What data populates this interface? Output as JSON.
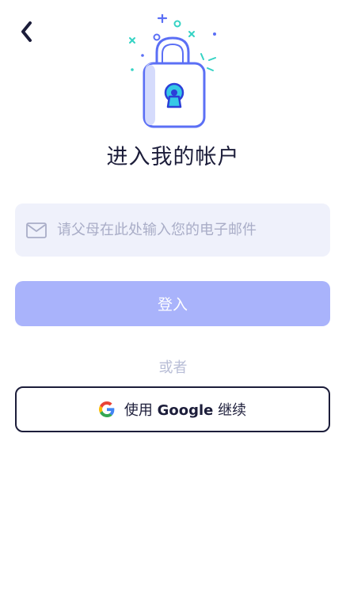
{
  "nav": {
    "back_icon": "chevron-left-icon"
  },
  "header": {
    "illustration": "padlock-icon",
    "title": "进入我的帐户"
  },
  "login_form": {
    "email_placeholder": "请父母在此处输入您的电子邮件",
    "email_value": "",
    "email_icon": "mail-icon",
    "submit_label": "登入"
  },
  "divider": {
    "or_label": "或者"
  },
  "google_signin": {
    "icon": "google-g-icon",
    "label_prefix": "使用 ",
    "label_brand": "Google",
    "label_suffix": " 继续"
  },
  "colors": {
    "accent": "#a9b3fb",
    "field_bg": "#eff1fb",
    "text_dark": "#1c1d3a",
    "muted": "#b8bdd6"
  }
}
